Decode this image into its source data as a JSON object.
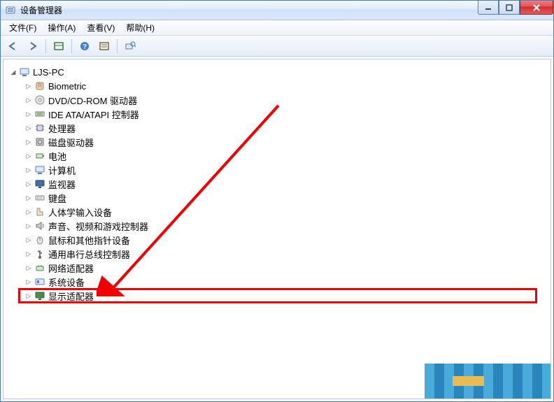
{
  "window": {
    "title": "设备管理器"
  },
  "menubar": {
    "file": "文件(F)",
    "action": "操作(A)",
    "view": "查看(V)",
    "help": "帮助(H)"
  },
  "toolbar": {
    "back": "back",
    "forward": "forward",
    "show_hidden": "show-hidden",
    "help": "help",
    "properties": "properties",
    "scan": "scan-hardware"
  },
  "tree": {
    "root": "LJS-PC",
    "nodes": [
      {
        "label": "Biometric",
        "icon": "biometric"
      },
      {
        "label": "DVD/CD-ROM 驱动器",
        "icon": "optical"
      },
      {
        "label": "IDE ATA/ATAPI 控制器",
        "icon": "ide"
      },
      {
        "label": "处理器",
        "icon": "cpu"
      },
      {
        "label": "磁盘驱动器",
        "icon": "disk"
      },
      {
        "label": "电池",
        "icon": "battery"
      },
      {
        "label": "计算机",
        "icon": "computer"
      },
      {
        "label": "监视器",
        "icon": "monitor"
      },
      {
        "label": "键盘",
        "icon": "keyboard"
      },
      {
        "label": "人体学输入设备",
        "icon": "hid"
      },
      {
        "label": "声音、视频和游戏控制器",
        "icon": "sound"
      },
      {
        "label": "鼠标和其他指针设备",
        "icon": "mouse"
      },
      {
        "label": "通用串行总线控制器",
        "icon": "usb"
      },
      {
        "label": "网络适配器",
        "icon": "network"
      },
      {
        "label": "系统设备",
        "icon": "system"
      },
      {
        "label": "显示适配器",
        "icon": "display",
        "highlighted": true
      }
    ]
  },
  "annotation": {
    "arrow_color": "#f20000"
  }
}
